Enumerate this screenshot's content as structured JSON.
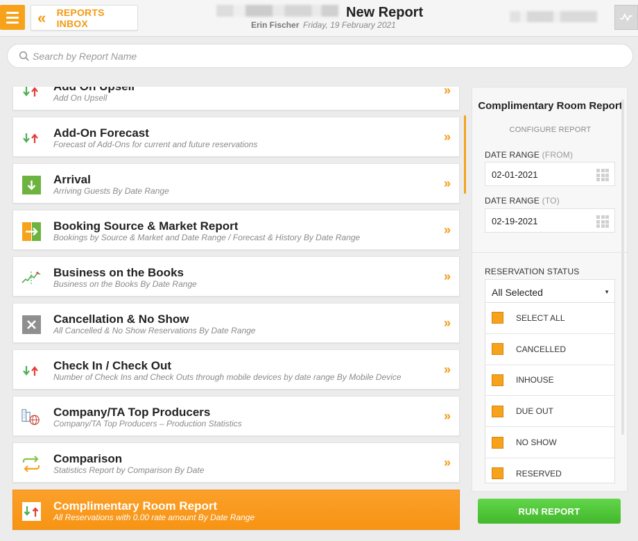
{
  "header": {
    "menu_icon": "hamburger-menu-icon",
    "back_label": "REPORTS INBOX",
    "back_icon": "double-chevron-left-icon",
    "title": "New Report",
    "user": "Erin Fischer",
    "date": "Friday, 19 February 2021",
    "graph_icon": "activity-graph-icon"
  },
  "search": {
    "placeholder": "Search by Report Name",
    "icon": "search-icon"
  },
  "reports": [
    {
      "name": "Add On Upsell",
      "desc": "Add On Upsell",
      "icon": "arrows-down-up-icon"
    },
    {
      "name": "Add-On Forecast",
      "desc": "Forecast of Add-Ons for current and future reservations",
      "icon": "arrows-down-up-icon"
    },
    {
      "name": "Arrival",
      "desc": "Arriving Guests By Date Range",
      "icon": "arrival-down-arrow-icon"
    },
    {
      "name": "Booking Source & Market Report",
      "desc": "Bookings by Source & Market and Date Range / Forecast & History By Date Range",
      "icon": "booking-source-icon"
    },
    {
      "name": "Business on the Books",
      "desc": "Business on the Books By Date Range",
      "icon": "trend-chart-icon"
    },
    {
      "name": "Cancellation & No Show",
      "desc": "All Cancelled & No Show Reservations By Date Range",
      "icon": "cancel-x-icon"
    },
    {
      "name": "Check In / Check Out",
      "desc": "Number of Check Ins and Check Outs through mobile devices by date range By Mobile Device",
      "icon": "arrows-down-up-icon"
    },
    {
      "name": "Company/TA Top Producers",
      "desc": "Company/TA Top Producers – Production Statistics",
      "icon": "company-globe-icon"
    },
    {
      "name": "Comparison",
      "desc": "Statistics Report by Comparison By Date",
      "icon": "compare-arrows-icon"
    },
    {
      "name": "Complimentary Room Report",
      "desc": "All Reservations with 0.00 rate amount By Date Range",
      "icon": "arrows-down-up-icon",
      "selected": true
    }
  ],
  "config": {
    "title": "Complimentary Room Report",
    "subtitle": "CONFIGURE REPORT",
    "from_label": "DATE RANGE",
    "from_suffix": "(FROM)",
    "from_value": "02-01-2021",
    "to_label": "DATE RANGE",
    "to_suffix": "(TO)",
    "to_value": "02-19-2021",
    "status_label": "RESERVATION STATUS",
    "status_value": "All Selected",
    "status_options": [
      "SELECT ALL",
      "CANCELLED",
      "INHOUSE",
      "DUE OUT",
      "NO SHOW",
      "RESERVED"
    ],
    "run_label": "RUN REPORT"
  },
  "colors": {
    "accent": "#f7a21b",
    "run_button": "#4cc236"
  }
}
